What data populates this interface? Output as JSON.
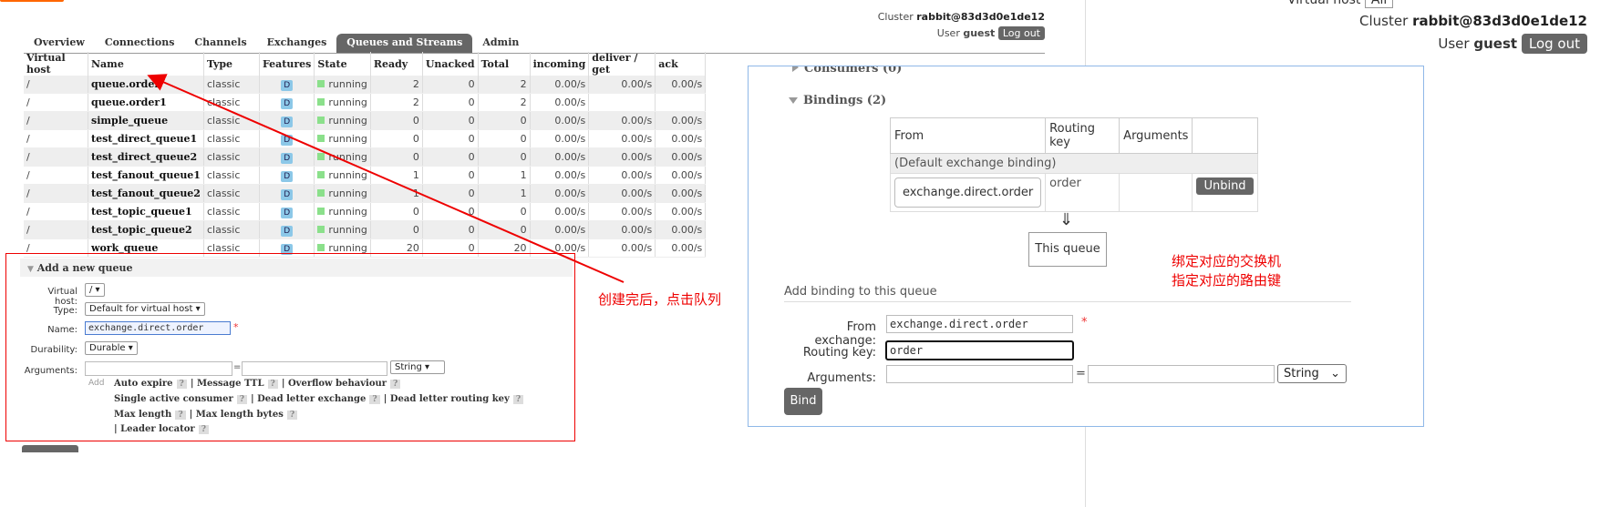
{
  "header": {
    "virtual_host_label": "Virtual host",
    "virtual_host_value": "All",
    "cluster_label": "Cluster",
    "cluster_name": "rabbit@83d3d0e1de12",
    "user_label": "User",
    "user_name": "guest",
    "logout": "Log out"
  },
  "tabs": [
    {
      "label": "Overview"
    },
    {
      "label": "Connections"
    },
    {
      "label": "Channels"
    },
    {
      "label": "Exchanges"
    },
    {
      "label": "Queues and Streams",
      "active": true
    },
    {
      "label": "Admin"
    }
  ],
  "queue_table": {
    "headers": [
      "Virtual host",
      "Name",
      "Type",
      "Features",
      "State",
      "Ready",
      "Unacked",
      "Total",
      "incoming",
      "deliver / get",
      "ack"
    ],
    "rows": [
      {
        "vhost": "/",
        "name": "queue.order",
        "type": "classic",
        "feature": "D",
        "state": "running",
        "ready": "2",
        "unacked": "0",
        "total": "2",
        "incoming": "0.00/s",
        "deliver": "0.00/s",
        "ack": "0.00/s"
      },
      {
        "vhost": "/",
        "name": "queue.order1",
        "type": "classic",
        "feature": "D",
        "state": "running",
        "ready": "2",
        "unacked": "0",
        "total": "2",
        "incoming": "0.00/s",
        "deliver": "",
        "ack": ""
      },
      {
        "vhost": "/",
        "name": "simple_queue",
        "type": "classic",
        "feature": "D",
        "state": "running",
        "ready": "0",
        "unacked": "0",
        "total": "0",
        "incoming": "0.00/s",
        "deliver": "0.00/s",
        "ack": "0.00/s"
      },
      {
        "vhost": "/",
        "name": "test_direct_queue1",
        "type": "classic",
        "feature": "D",
        "state": "running",
        "ready": "0",
        "unacked": "0",
        "total": "0",
        "incoming": "0.00/s",
        "deliver": "0.00/s",
        "ack": "0.00/s"
      },
      {
        "vhost": "/",
        "name": "test_direct_queue2",
        "type": "classic",
        "feature": "D",
        "state": "running",
        "ready": "0",
        "unacked": "0",
        "total": "0",
        "incoming": "0.00/s",
        "deliver": "0.00/s",
        "ack": "0.00/s"
      },
      {
        "vhost": "/",
        "name": "test_fanout_queue1",
        "type": "classic",
        "feature": "D",
        "state": "running",
        "ready": "1",
        "unacked": "0",
        "total": "1",
        "incoming": "0.00/s",
        "deliver": "0.00/s",
        "ack": "0.00/s"
      },
      {
        "vhost": "/",
        "name": "test_fanout_queue2",
        "type": "classic",
        "feature": "D",
        "state": "running",
        "ready": "1",
        "unacked": "0",
        "total": "1",
        "incoming": "0.00/s",
        "deliver": "0.00/s",
        "ack": "0.00/s"
      },
      {
        "vhost": "/",
        "name": "test_topic_queue1",
        "type": "classic",
        "feature": "D",
        "state": "running",
        "ready": "0",
        "unacked": "0",
        "total": "0",
        "incoming": "0.00/s",
        "deliver": "0.00/s",
        "ack": "0.00/s"
      },
      {
        "vhost": "/",
        "name": "test_topic_queue2",
        "type": "classic",
        "feature": "D",
        "state": "running",
        "ready": "0",
        "unacked": "0",
        "total": "0",
        "incoming": "0.00/s",
        "deliver": "0.00/s",
        "ack": "0.00/s"
      },
      {
        "vhost": "/",
        "name": "work_queue",
        "type": "classic",
        "feature": "D",
        "state": "running",
        "ready": "20",
        "unacked": "0",
        "total": "20",
        "incoming": "0.00/s",
        "deliver": "0.00/s",
        "ack": "0.00/s"
      }
    ]
  },
  "add_queue": {
    "heading": "Add a new queue",
    "virtual_host_label": "Virtual host:",
    "virtual_host_value": "/",
    "type_label": "Type:",
    "type_value": "Default for virtual host",
    "name_label": "Name:",
    "name_value": "exchange.direct.order",
    "required_mark": "*",
    "durability_label": "Durability:",
    "durability_value": "Durable",
    "arguments_label": "Arguments:",
    "arguments_type": "String",
    "equals": "=",
    "add_label": "Add",
    "help_mark": "?",
    "separator": "|",
    "arg_links": [
      "Auto expire",
      "Message TTL",
      "Overflow behaviour",
      "Single active consumer",
      "Dead letter exchange",
      "Dead letter routing key",
      "Max length",
      "Max length bytes",
      "Leader locator"
    ]
  },
  "annotation_left": "创建完后，点击队列",
  "right_panel": {
    "consumers_heading": "Consumers (0)",
    "bindings_heading": "Bindings (2)",
    "binding_headers": [
      "From",
      "Routing key",
      "Arguments"
    ],
    "default_binding": "(Default exchange binding)",
    "binding_from": "exchange.direct.order",
    "binding_routing_key": "order",
    "unbind": "Unbind",
    "down_arrow": "⇓",
    "this_queue": "This queue",
    "annotation": [
      "绑定对应的交换机",
      "指定对应的路由键"
    ],
    "add_binding_heading": "Add binding to this queue",
    "from_exchange_label": "From exchange:",
    "from_exchange_value": "exchange.direct.order",
    "required_mark": "*",
    "routing_key_label": "Routing key:",
    "routing_key_value": "order",
    "arguments_label": "Arguments:",
    "equals": "=",
    "arguments_type": "String",
    "bind": "Bind"
  },
  "colors": {
    "annotation_red": "#e00000",
    "active_tab": "#666666",
    "feature_badge": "#8cc8e8",
    "running_dot": "#8be08b",
    "panel_border": "#8fb8e8"
  }
}
